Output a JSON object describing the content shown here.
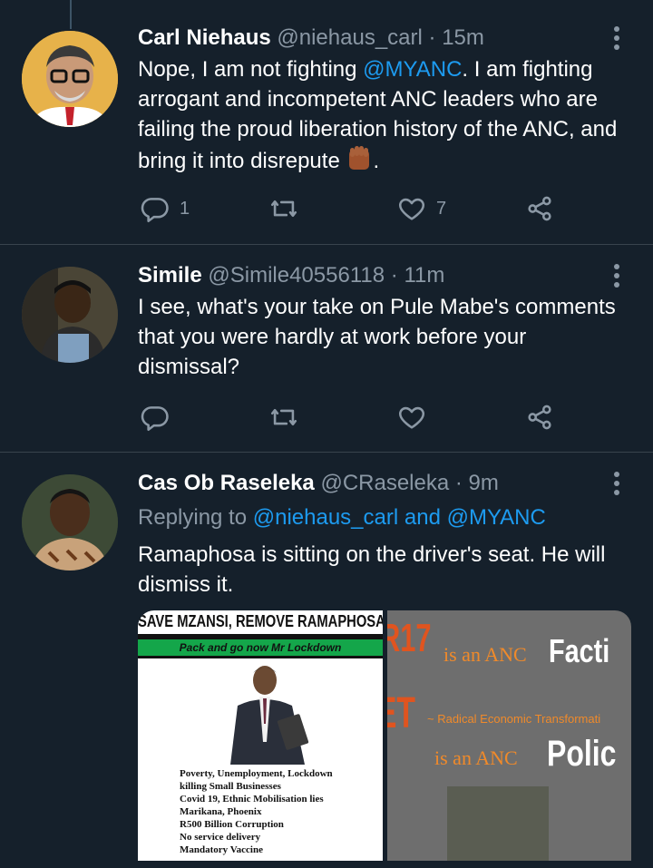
{
  "tweets": [
    {
      "name": "Carl Niehaus",
      "handle": "@niehaus_carl",
      "time": "15m",
      "body_pre": "Nope, I am not fighting ",
      "body_mention": "@MYANC",
      "body_post": ". I am fighting arrogant and incompetent ANC leaders who are failing the proud liberation history of the ANC, and bring it into disrepute ",
      "body_end": ".",
      "reply_count": "1",
      "like_count": "7"
    },
    {
      "name": "Simile",
      "handle": "@Simile40556118",
      "time": "11m",
      "body": "I see, what's your take on Pule Mabe's comments that you were hardly at work before your dismissal?",
      "reply_count": "",
      "like_count": ""
    },
    {
      "name": "Cas Ob Raseleka",
      "handle": "@CRaseleka",
      "time": "9m",
      "replying_prefix": "Replying to ",
      "replying_user1": "@niehaus_carl",
      "replying_and": " and ",
      "replying_user2": "@MYANC",
      "body": "Ramaphosa is sitting on the driver's seat. He will dismiss it."
    }
  ],
  "media": {
    "poster_title": "SAVE MZANSI, REMOVE RAMAPHOSA",
    "poster_subtitle": "Pack and go now Mr Lockdown",
    "poster_lines": [
      "Poverty, Unemployment, Lockdown",
      "killing Small Businesses",
      "Covid 19, Ethnic Mobilisation lies",
      "Marikana, Phoenix",
      "R500 Billion Corruption",
      "No service delivery",
      "Mandatory Vaccine"
    ],
    "right_line1_a": "R17",
    "right_line1_b": "is an ANC",
    "right_line1_c": "Facti",
    "right_line2_a": "ET",
    "right_line2_b": "~ Radical Economic Transformati",
    "right_line3_a": "is an ANC",
    "right_line3_b": "Polic"
  },
  "colors": {
    "background": "#15202b",
    "text": "#ffffff",
    "muted": "#8b98a5",
    "link": "#1d9bf0",
    "separator": "#38444d"
  }
}
